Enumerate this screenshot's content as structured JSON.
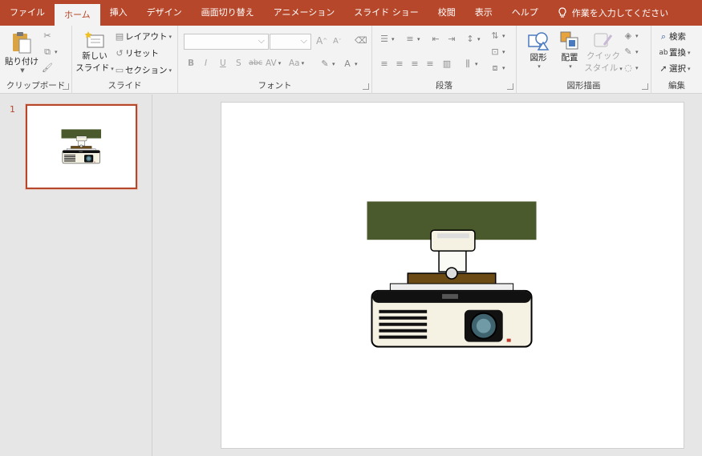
{
  "tabs": [
    "ファイル",
    "ホーム",
    "挿入",
    "デザイン",
    "画面切り替え",
    "アニメーション",
    "スライド ショー",
    "校閲",
    "表示",
    "ヘルプ"
  ],
  "tell_me": "作業を入力してください",
  "ribbon": {
    "clipboard": {
      "paste": "貼り付け",
      "label": "クリップボード"
    },
    "slides": {
      "new_slide_line1": "新しい",
      "new_slide_line2": "スライド",
      "layout": "レイアウト",
      "reset": "リセット",
      "section": "セクション",
      "label": "スライド"
    },
    "font": {
      "label": "フォント",
      "bold": "B",
      "italic": "I",
      "underline": "U",
      "shadow": "S",
      "strike": "abc",
      "spacing": "AV",
      "case": "Aa",
      "grow": "A",
      "shrink": "A"
    },
    "paragraph": {
      "label": "段落"
    },
    "drawing": {
      "shapes": "図形",
      "arrange": "配置",
      "quick_style_line1": "クイック",
      "quick_style_line2": "スタイル",
      "label": "図形描画"
    },
    "editing": {
      "find": "検索",
      "replace": "置換",
      "select": "選択",
      "label": "編集"
    }
  },
  "slide_panel": {
    "slide_number": "1"
  },
  "colors": {
    "accent": "#b7472a",
    "banner": "#4a5a2c",
    "projector_body": "#f5f2e3",
    "mount": "#6b4a14"
  }
}
